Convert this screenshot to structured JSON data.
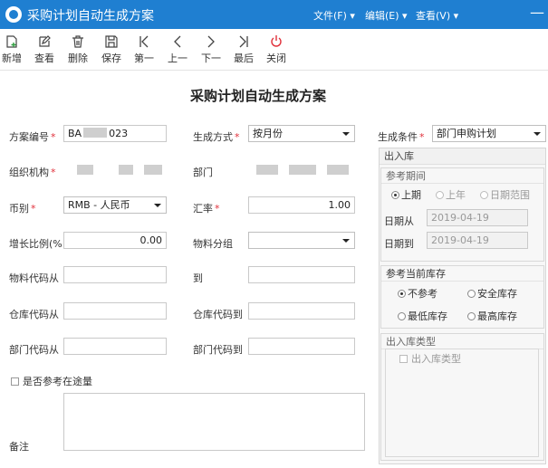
{
  "window": {
    "title": "采购计划自动生成方案",
    "menus": [
      "文件(F)",
      "编辑(E)",
      "查看(V)"
    ],
    "minimize": "—"
  },
  "toolbar": {
    "items": [
      "新增",
      "查看",
      "删除",
      "保存",
      "第一",
      "上一",
      "下一",
      "最后",
      "关闭"
    ]
  },
  "form": {
    "title": "采购计划自动生成方案",
    "plan_no_label": "方案编号",
    "plan_no_value_a": "BA",
    "plan_no_value_b": "023",
    "org_label": "组织机构",
    "currency_label": "币别",
    "currency_value": "RMB - 人民币",
    "growth_label": "增长比例(%",
    "growth_value": "0.00",
    "material_from_label": "物料代码从",
    "warehouse_from_label": "仓库代码从",
    "dept_from_label": "部门代码从",
    "gen_method_label": "生成方式",
    "gen_method_value": "按月份",
    "dept_label": "部门",
    "rate_label": "汇率",
    "rate_value": "1.00",
    "material_group_label": "物料分组",
    "to_label": "到",
    "warehouse_to_label": "仓库代码到",
    "dept_to_label": "部门代码到",
    "in_transit_label": "是否参考在途量",
    "remark_label": "备注",
    "gen_condition_label": "生成条件",
    "gen_condition_value": "部门申购计划"
  },
  "panel": {
    "title": "出入库",
    "period_title": "参考期间",
    "period_options": [
      "上期",
      "上年",
      "日期范围"
    ],
    "date_from_label": "日期从",
    "date_from_value": "2019-04-19",
    "date_to_label": "日期到",
    "date_to_value": "2019-04-19",
    "stock_title": "参考当前库存",
    "stock_options": [
      "不参考",
      "安全库存",
      "最低库存",
      "最高库存"
    ],
    "io_type_title": "出入库类型",
    "io_type_item": "出入库类型"
  },
  "colors": {
    "titlebar": "#1f7fd1",
    "required": "#e0303a",
    "close_icon": "#e0303a"
  }
}
